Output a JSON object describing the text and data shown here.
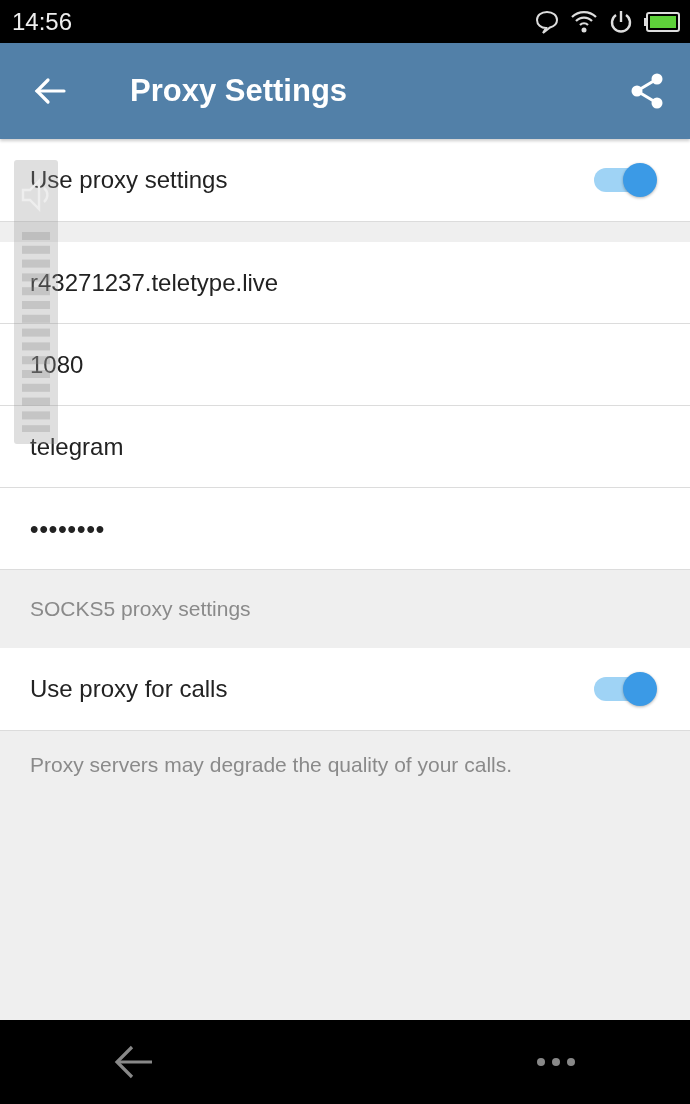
{
  "status_bar": {
    "time": "14:56"
  },
  "app_bar": {
    "title": "Proxy Settings"
  },
  "proxy_toggle": {
    "label": "Use proxy settings",
    "on": true
  },
  "fields": [
    {
      "kind": "text",
      "value": "r43271237.teletype.live"
    },
    {
      "kind": "text",
      "value": "1080"
    },
    {
      "kind": "text",
      "value": "telegram"
    },
    {
      "kind": "password",
      "value": "••••••••"
    }
  ],
  "section_caption": "SOCKS5 proxy settings",
  "calls_toggle": {
    "label": "Use proxy for calls",
    "on": true
  },
  "calls_note": "Proxy servers may degrade the quality of your calls.",
  "volume_overlay": {
    "muted": false
  }
}
